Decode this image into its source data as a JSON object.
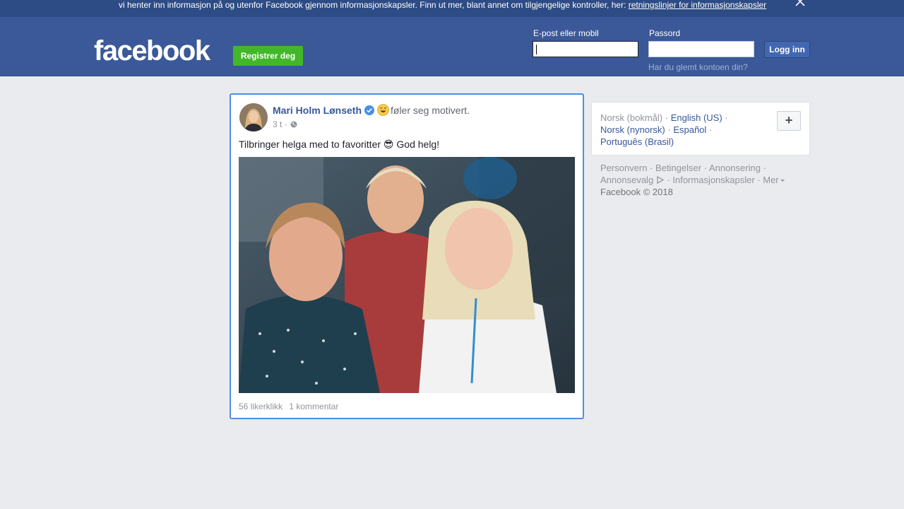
{
  "cookie_banner": {
    "text": "vi henter inn informasjon på og utenfor Facebook gjennom informasjonskapsler. Finn ut mer, blant annet om tilgjengelige kontroller, her: ",
    "link": "retningslinjer for informasjonskapsler"
  },
  "header": {
    "logo": "facebook",
    "register_label": "Registrer deg",
    "email_label": "E-post eller mobil",
    "email_value": "",
    "password_label": "Passord",
    "password_value": "",
    "login_label": "Logg inn",
    "forgot_link": "Har du glemt kontoen din?"
  },
  "post": {
    "author": "Mari Holm Lønseth",
    "feeling": "føler seg motivert.",
    "time": "3 t ·",
    "text": "Tilbringer helga med to favoritter 😎 God helg!",
    "likes": "56 likerklikk",
    "comments": "1 kommentar"
  },
  "languages": {
    "current": "Norsk (bokmål) ·",
    "items": [
      "English (US)",
      "Norsk (nynorsk)",
      "Español",
      "Português (Brasil)"
    ],
    "add_label": "+"
  },
  "footer": {
    "links": [
      "Personvern",
      "Betingelser",
      "Annonsering",
      "Annonsevalg",
      "Informasjonskapsler",
      "Mer"
    ],
    "copyright": "Facebook © 2018"
  },
  "colors": {
    "brand": "#3b5998",
    "banner": "#2d4b84",
    "register_green": "#42b72a",
    "link": "#365899",
    "focus_border": "#4a90e2"
  }
}
